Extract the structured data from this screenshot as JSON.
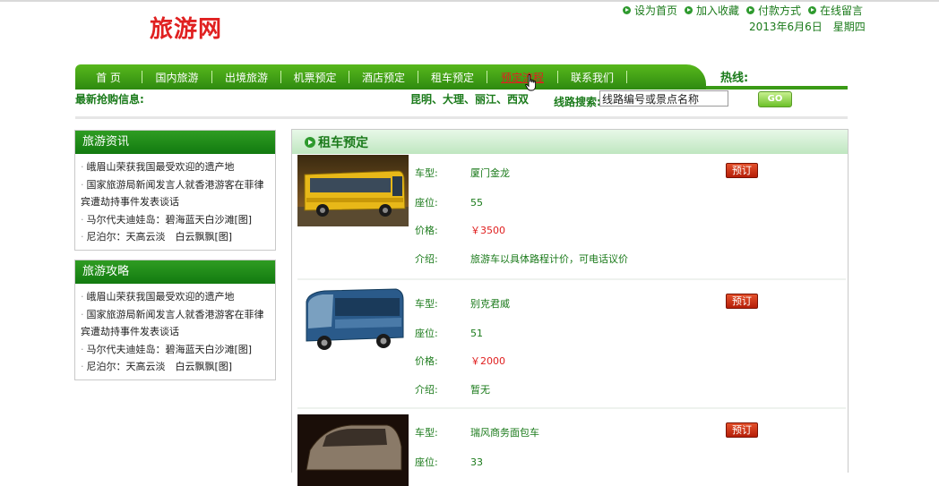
{
  "site": {
    "logo": "旅游网"
  },
  "top_links": [
    {
      "label": "设为首页"
    },
    {
      "label": "加入收藏"
    },
    {
      "label": "付款方式"
    },
    {
      "label": "在线留言"
    }
  ],
  "date": "2013年6月6日　星期四",
  "nav": {
    "items": [
      {
        "label": "首  页"
      },
      {
        "label": "国内旅游"
      },
      {
        "label": "出境旅游"
      },
      {
        "label": "机票预定"
      },
      {
        "label": "酒店预定"
      },
      {
        "label": "租车预定"
      },
      {
        "label": "预定流程"
      },
      {
        "label": "联系我们"
      }
    ],
    "active_index": 6,
    "hotline_label": "热线:"
  },
  "info_bar": {
    "label": "最新抢购信息:",
    "cities": "昆明、大理、丽江、西双",
    "search_label": "线路搜索:",
    "search_value": "线路编号或景点名称",
    "go_label": "GO"
  },
  "sidebar": {
    "news": {
      "title": "旅游资讯",
      "items": [
        "峨眉山荣获我国最受欢迎的遗产地",
        "国家旅游局新闻发言人就香港游客在菲律宾遭劫持事件发表谈话",
        "马尔代夫迪娃岛：碧海蓝天白沙滩[图]",
        "尼泊尔：天高云淡　白云飘飘[图]"
      ]
    },
    "guides": {
      "title": "旅游攻略",
      "items": [
        "峨眉山荣获我国最受欢迎的遗产地",
        "国家旅游局新闻发言人就香港游客在菲律宾遭劫持事件发表谈话",
        "马尔代夫迪娃岛：碧海蓝天白沙滩[图]",
        "尼泊尔：天高云淡　白云飘飘[图]"
      ]
    }
  },
  "main": {
    "title": "租车预定",
    "labels": {
      "type": "车型:",
      "seats": "座位:",
      "price": "价格:",
      "intro": "介绍:"
    },
    "book_label": "预订",
    "cars": [
      {
        "type": "厦门金龙",
        "seats": "55",
        "price": "￥3500",
        "intro": "旅游车以具体路程计价，可电话议价"
      },
      {
        "type": "别克君威",
        "seats": "51",
        "price": "￥2000",
        "intro": "暂无"
      },
      {
        "type": "瑞风商务面包车",
        "seats": "33",
        "price": "",
        "intro": ""
      }
    ]
  },
  "colors": {
    "brand_green": "#2e8a10",
    "accent_red": "#e02020",
    "text_green": "#1a7a1a"
  }
}
